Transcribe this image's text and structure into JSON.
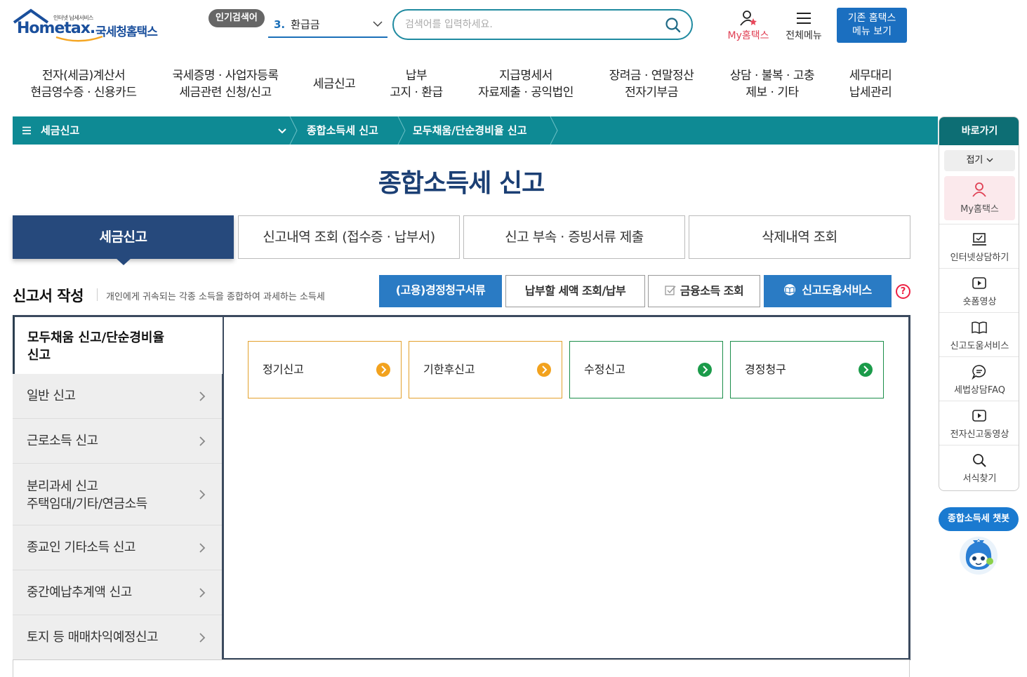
{
  "header": {
    "logo_small": "인터넷 납세서비스",
    "logo_brand": "Hometax.",
    "logo_kr": "국세청홈택스",
    "popular_badge": "인기검색어",
    "popular_rank": "3.",
    "popular_term": "환급금",
    "search_placeholder": "검색어를 입력하세요.",
    "my_hometax": "My홈택스",
    "all_menu": "전체메뉴",
    "old_menu_line1": "기존 홈택스",
    "old_menu_line2": "메뉴 보기"
  },
  "gnb": [
    {
      "l1": "전자(세금)계산서",
      "l2": "현금영수증 · 신용카드"
    },
    {
      "l1": "국세증명 · 사업자등록",
      "l2": "세금관련 신청/신고"
    },
    {
      "l1": "세금신고",
      "l2": ""
    },
    {
      "l1": "납부",
      "l2": "고지 · 환급"
    },
    {
      "l1": "지급명세서",
      "l2": "자료제출 · 공익법인"
    },
    {
      "l1": "장려금 · 연말정산",
      "l2": "전자기부금"
    },
    {
      "l1": "상담 · 불복 · 고충",
      "l2": "제보 · 기타"
    },
    {
      "l1": "세무대리",
      "l2": "납세관리"
    }
  ],
  "location": {
    "menu": "세금신고",
    "crumb1": "종합소득세 신고",
    "crumb2": "모두채움/단순경비율 신고"
  },
  "quick": {
    "title": "바로가기",
    "fold": "접기",
    "items": [
      "My홈택스",
      "인터넷상담하기",
      "숏폼영상",
      "신고도움서비스",
      "세법상담FAQ",
      "전자신고동영상",
      "서식찾기"
    ]
  },
  "chatbot_label": "종합소득세 챗봇",
  "page_title": "종합소득세 신고",
  "tabs": [
    "세금신고",
    "신고내역 조회 (접수증 · 납부서)",
    "신고 부속 · 증빙서류 제출",
    "삭제내역 조회"
  ],
  "section": {
    "title": "신고서 작성",
    "desc": "개인에게 귀속되는 각종 소득을 종합하여 과세하는 소득세"
  },
  "actions": [
    "(고용)경정청구서류",
    "납부할 세액 조회/납부",
    "금융소득 조회",
    "신고도움서비스"
  ],
  "help_mark": "?",
  "side_active": {
    "l1": "모두채움 신고/단순경비율",
    "l2": "신고"
  },
  "side_items": [
    {
      "l1": "일반 신고",
      "l2": ""
    },
    {
      "l1": "근로소득 신고",
      "l2": ""
    },
    {
      "l1": "분리과세 신고",
      "l2": "주택임대/기타/연금소득"
    },
    {
      "l1": "종교인 기타소득 신고",
      "l2": ""
    },
    {
      "l1": "중간예납추계액 신고",
      "l2": ""
    },
    {
      "l1": "토지 등 매매차익예정신고",
      "l2": ""
    }
  ],
  "cards": [
    {
      "label": "정기신고",
      "color": "#f2a21e"
    },
    {
      "label": "기한후신고",
      "color": "#f2a21e"
    },
    {
      "label": "수정신고",
      "color": "#1b9b4a"
    },
    {
      "label": "경정청구",
      "color": "#1b9b4a"
    }
  ]
}
